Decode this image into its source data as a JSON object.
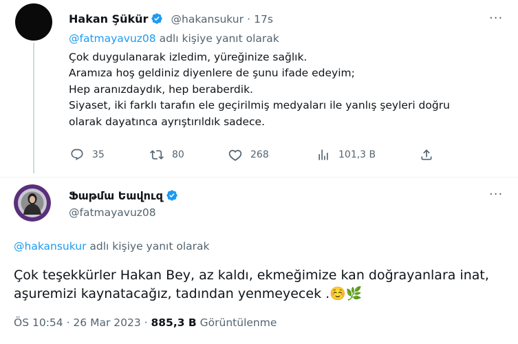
{
  "tweet1": {
    "author_name": "Hakan Şükür",
    "handle": "@hakansukur",
    "separator": "·",
    "time": "17s",
    "more": "···",
    "reply_to_handle": "@fatmayavuz08",
    "reply_to_suffix": " adlı kişiye yanıt olarak",
    "lines": [
      "Çok duygulanarak izledim, yüreğinize sağlık.",
      "Aramıza hoş geldiniz diyenlere de şunu ifade edeyim;",
      "Hep aranızdaydık, hep beraberdik.",
      "Siyaset, iki farklı tarafın ele geçirilmiş medyaları ile yanlış şeyleri doğru",
      "olarak dayatınca ayrıştırıldık sadece."
    ],
    "actions": {
      "replies": "35",
      "retweets": "80",
      "likes": "268",
      "views": "101,3 B"
    }
  },
  "tweet2": {
    "author_name": "Ֆաթմա Եավուզ",
    "handle": "@fatmayavuz08",
    "more": "···",
    "reply_to_handle": "@hakansukur",
    "reply_to_suffix": " adlı kişiye yanıt olarak",
    "lines": [
      "Çok teşekkürler Hakan Bey, az kaldı, ekmeğimize kan doğrayanlara inat,",
      "aşuremizi kaynatacağız, tadından yenmeyecek ."
    ],
    "emoji": [
      "☺️",
      "🌿"
    ],
    "meta": {
      "time": "ÖS 10:54",
      "sep1": " · ",
      "date": "26 Mar 2023",
      "sep2": " · ",
      "views": "885,3 B",
      "views_label": " Görüntülenme"
    }
  },
  "colors": {
    "link": "#1d9bf0",
    "muted": "#536471",
    "text": "#0f1419",
    "verified": "#1d9bf0"
  }
}
